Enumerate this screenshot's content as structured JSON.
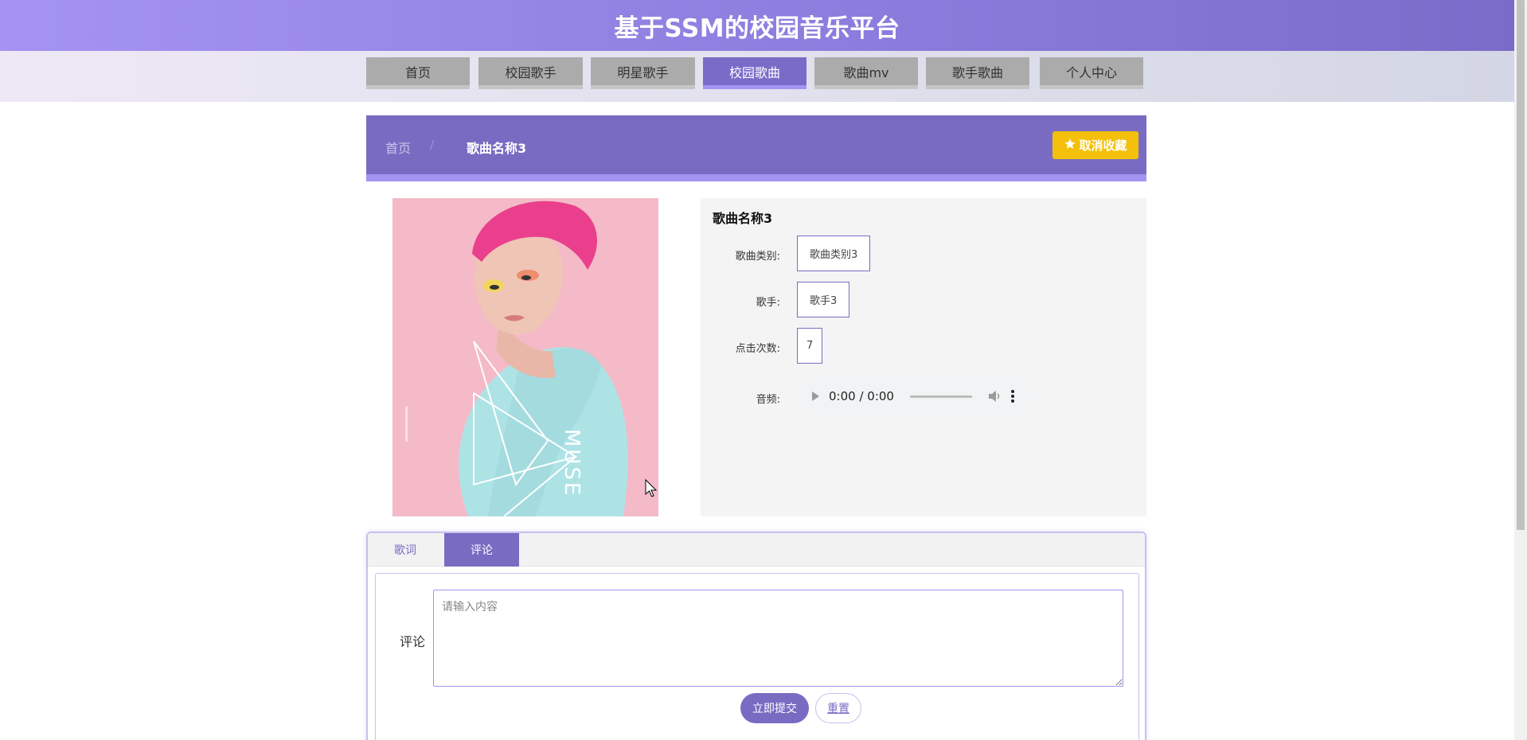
{
  "site": {
    "title": "基于SSM的校园音乐平台"
  },
  "nav": {
    "items": [
      {
        "label": "首页"
      },
      {
        "label": "校园歌手"
      },
      {
        "label": "明星歌手"
      },
      {
        "label": "校园歌曲"
      },
      {
        "label": "歌曲mv"
      },
      {
        "label": "歌手歌曲"
      },
      {
        "label": "个人中心"
      }
    ],
    "active": "校园歌曲"
  },
  "breadcrumb": {
    "home": "首页",
    "separator": "/",
    "current": "歌曲名称3"
  },
  "favorite_button": {
    "label": "取消收藏",
    "icon": "star-icon"
  },
  "song": {
    "name": "歌曲名称3",
    "fields": {
      "category_label": "歌曲类别:",
      "category_value": "歌曲类别3",
      "singer_label": "歌手:",
      "singer_value": "歌手3",
      "clicks_label": "点击次数:",
      "clicks_value": "7",
      "audio_label": "音频:"
    },
    "audio": {
      "time": "0:00 / 0:00"
    }
  },
  "cover": {
    "text": "MUSE"
  },
  "tabs": [
    {
      "label": "歌词"
    },
    {
      "label": "评论"
    }
  ],
  "active_tab": "评论",
  "comment": {
    "label": "评论",
    "placeholder": "请输入内容",
    "submit_label": "立即提交",
    "reset_label": "重置"
  },
  "colors": {
    "header_start": "#a493f2",
    "accent": "#7a6bc2",
    "favorite": "#f4c00b",
    "nav_inactive": "#ababab"
  }
}
